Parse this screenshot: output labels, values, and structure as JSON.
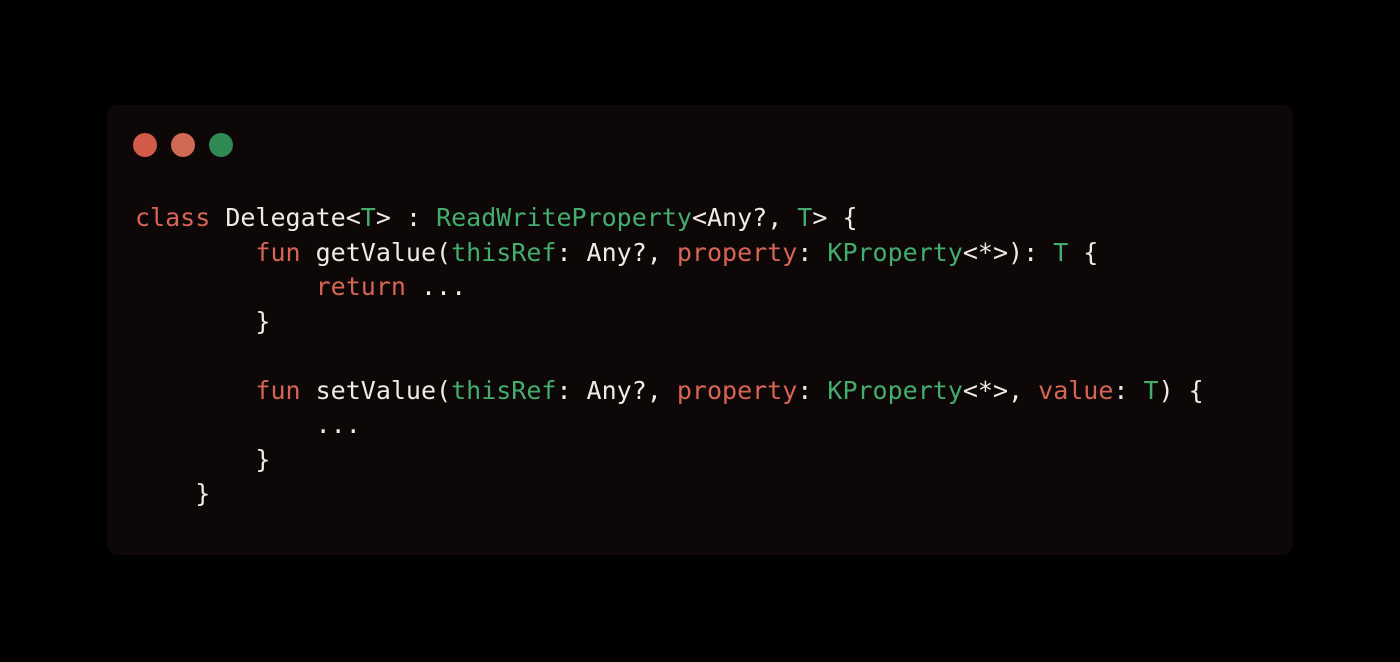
{
  "window": {
    "controls": [
      {
        "name": "close",
        "color": "#d25a48"
      },
      {
        "name": "minimize",
        "color": "#d06a56"
      },
      {
        "name": "maximize",
        "color": "#2f8a54"
      }
    ]
  },
  "colors": {
    "keyword": "#d66556",
    "type": "#44ad6e",
    "plain": "#f0ebe6",
    "background": "#0d0807"
  },
  "code": {
    "lines": [
      [
        {
          "t": "kw",
          "v": "class"
        },
        {
          "t": "pl",
          "v": " Delegate<"
        },
        {
          "t": "ty",
          "v": "T"
        },
        {
          "t": "pl",
          "v": "> : "
        },
        {
          "t": "ty",
          "v": "ReadWriteProperty"
        },
        {
          "t": "pl",
          "v": "<Any?, "
        },
        {
          "t": "ty",
          "v": "T"
        },
        {
          "t": "pl",
          "v": "> {"
        }
      ],
      [
        {
          "t": "pl",
          "v": "        "
        },
        {
          "t": "kw",
          "v": "fun"
        },
        {
          "t": "pl",
          "v": " getValue("
        },
        {
          "t": "ty",
          "v": "thisRef"
        },
        {
          "t": "pl",
          "v": ": Any?, "
        },
        {
          "t": "kw",
          "v": "property"
        },
        {
          "t": "pl",
          "v": ": "
        },
        {
          "t": "ty",
          "v": "KProperty"
        },
        {
          "t": "pl",
          "v": "<*>): "
        },
        {
          "t": "ty",
          "v": "T"
        },
        {
          "t": "pl",
          "v": " {"
        }
      ],
      [
        {
          "t": "pl",
          "v": "            "
        },
        {
          "t": "kw",
          "v": "return"
        },
        {
          "t": "pl",
          "v": " ..."
        }
      ],
      [
        {
          "t": "pl",
          "v": "        }"
        }
      ],
      [
        {
          "t": "pl",
          "v": ""
        }
      ],
      [
        {
          "t": "pl",
          "v": "        "
        },
        {
          "t": "kw",
          "v": "fun"
        },
        {
          "t": "pl",
          "v": " setValue("
        },
        {
          "t": "ty",
          "v": "thisRef"
        },
        {
          "t": "pl",
          "v": ": Any?, "
        },
        {
          "t": "kw",
          "v": "property"
        },
        {
          "t": "pl",
          "v": ": "
        },
        {
          "t": "ty",
          "v": "KProperty"
        },
        {
          "t": "pl",
          "v": "<*>, "
        },
        {
          "t": "kw",
          "v": "value"
        },
        {
          "t": "pl",
          "v": ": "
        },
        {
          "t": "ty",
          "v": "T"
        },
        {
          "t": "pl",
          "v": ") {"
        }
      ],
      [
        {
          "t": "pl",
          "v": "            ..."
        }
      ],
      [
        {
          "t": "pl",
          "v": "        }"
        }
      ],
      [
        {
          "t": "pl",
          "v": "    }"
        }
      ]
    ]
  }
}
